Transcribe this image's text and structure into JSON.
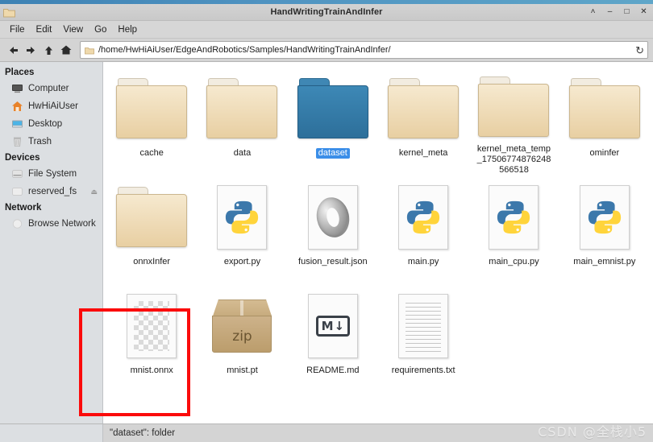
{
  "window": {
    "title": "HandWritingTrainAndInfer",
    "icon": "folder-icon",
    "controls": [
      {
        "name": "shade-button",
        "glyph": "˄"
      },
      {
        "name": "minimize-button",
        "glyph": "–"
      },
      {
        "name": "maximize-button",
        "glyph": "□"
      },
      {
        "name": "close-button",
        "glyph": "✕"
      }
    ]
  },
  "menubar": {
    "items": [
      {
        "label": "File"
      },
      {
        "label": "Edit"
      },
      {
        "label": "View"
      },
      {
        "label": "Go"
      },
      {
        "label": "Help"
      }
    ]
  },
  "toolbar": {
    "back_icon": "arrow-left-icon",
    "forward_icon": "arrow-right-icon",
    "up_icon": "arrow-up-icon",
    "home_icon": "home-icon",
    "path": "/home/HwHiAiUser/EdgeAndRobotics/Samples/HandWritingTrainAndInfer/",
    "reload_glyph": "↻"
  },
  "sidebar": {
    "sections": [
      {
        "heading": "Places",
        "items": [
          {
            "label": "Computer",
            "icon": "computer-icon"
          },
          {
            "label": "HwHiAiUser",
            "icon": "home-folder-icon"
          },
          {
            "label": "Desktop",
            "icon": "desktop-icon"
          },
          {
            "label": "Trash",
            "icon": "trash-icon"
          }
        ]
      },
      {
        "heading": "Devices",
        "items": [
          {
            "label": "File System",
            "icon": "drive-icon"
          },
          {
            "label": "reserved_fs",
            "icon": "drive-icon",
            "eject": "⏏"
          }
        ]
      },
      {
        "heading": "Network",
        "items": [
          {
            "label": "Browse Network",
            "icon": "network-icon"
          }
        ]
      }
    ]
  },
  "files": [
    {
      "name": "cache",
      "type": "folder",
      "selected": false
    },
    {
      "name": "data",
      "type": "folder",
      "selected": false
    },
    {
      "name": "dataset",
      "type": "folder",
      "selected": true
    },
    {
      "name": "kernel_meta",
      "type": "folder",
      "selected": false
    },
    {
      "name": "kernel_meta_temp_17506774876248566518",
      "type": "folder",
      "selected": false
    },
    {
      "name": "ominfer",
      "type": "folder",
      "selected": false
    },
    {
      "name": "onnxInfer",
      "type": "folder",
      "selected": false
    },
    {
      "name": "export.py",
      "type": "python",
      "selected": false
    },
    {
      "name": "fusion_result.json",
      "type": "json",
      "selected": false
    },
    {
      "name": "main.py",
      "type": "python",
      "selected": false
    },
    {
      "name": "main_cpu.py",
      "type": "python",
      "selected": false
    },
    {
      "name": "main_emnist.py",
      "type": "python",
      "selected": false
    },
    {
      "name": "mnist.onnx",
      "type": "onnx",
      "selected": false
    },
    {
      "name": "mnist.pt",
      "type": "zip",
      "selected": false,
      "badge": "zip"
    },
    {
      "name": "README.md",
      "type": "markdown",
      "selected": false,
      "badge": "M"
    },
    {
      "name": "requirements.txt",
      "type": "text",
      "selected": false
    }
  ],
  "statusbar": {
    "text": "\"dataset\": folder"
  },
  "watermark": {
    "text": "CSDN @全栈小5"
  },
  "annotation": {
    "name": "red-highlight-box",
    "color": "#fb0b0b"
  },
  "colors": {
    "selection_blue": "#3b8ee8",
    "folder_tan": "#e8cfa2",
    "folder_blue": "#2d6f9a",
    "accent_stripe": "#4f93c1"
  }
}
